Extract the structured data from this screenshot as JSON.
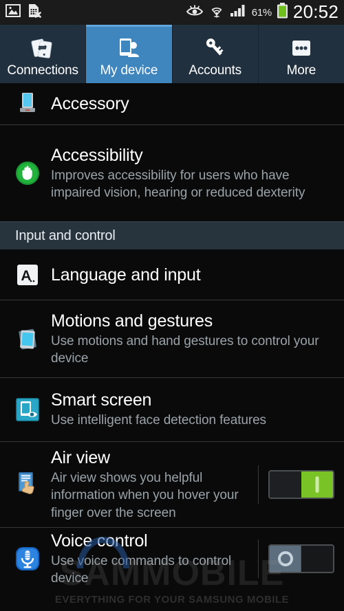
{
  "statusbar": {
    "left_icons": [
      "image-icon",
      "sim-card-error-icon"
    ],
    "right_icons": [
      "smart-stay-eye-icon",
      "wifi-icon",
      "signal-bars-icon",
      "battery-icon"
    ],
    "battery_percent": "61%",
    "clock": "20:52"
  },
  "tabs": [
    {
      "label": "Connections",
      "icon": "connections-icon",
      "active": false
    },
    {
      "label": "My device",
      "icon": "my-device-icon",
      "active": true
    },
    {
      "label": "Accounts",
      "icon": "accounts-key-icon",
      "active": false
    },
    {
      "label": "More",
      "icon": "more-dots-icon",
      "active": false
    }
  ],
  "rows": {
    "accessory": {
      "title": "Accessory",
      "icon": "dock-accessory-icon"
    },
    "accessibility": {
      "title": "Accessibility",
      "subtitle": "Improves accessibility for users who have impaired vision, hearing or reduced dexterity",
      "icon": "accessibility-hand-icon"
    },
    "section_input": {
      "label": "Input and control"
    },
    "language": {
      "title": "Language and input",
      "icon": "language-a-icon"
    },
    "motions": {
      "title": "Motions and gestures",
      "subtitle": "Use motions and hand gestures to control your device",
      "icon": "motions-phone-icon"
    },
    "smart_screen": {
      "title": "Smart screen",
      "subtitle": "Use intelligent face detection features",
      "icon": "smart-screen-eye-icon"
    },
    "air_view": {
      "title": "Air view",
      "subtitle": "Air view shows you helpful information when you hover your finger over the screen",
      "icon": "air-view-finger-icon",
      "toggle": "on"
    },
    "voice_control": {
      "title": "Voice control",
      "subtitle": "Use voice commands to control device",
      "icon": "voice-mic-icon",
      "toggle": "off"
    }
  },
  "watermark": {
    "main": "SAMMOBILE",
    "sub": "EVERYTHING FOR YOUR SAMSUNG MOBILE"
  },
  "colors": {
    "accent_tab": "#3f85be",
    "toggle_on": "#79c326",
    "section_bg": "#27333d",
    "background": "#0a0a0a"
  }
}
